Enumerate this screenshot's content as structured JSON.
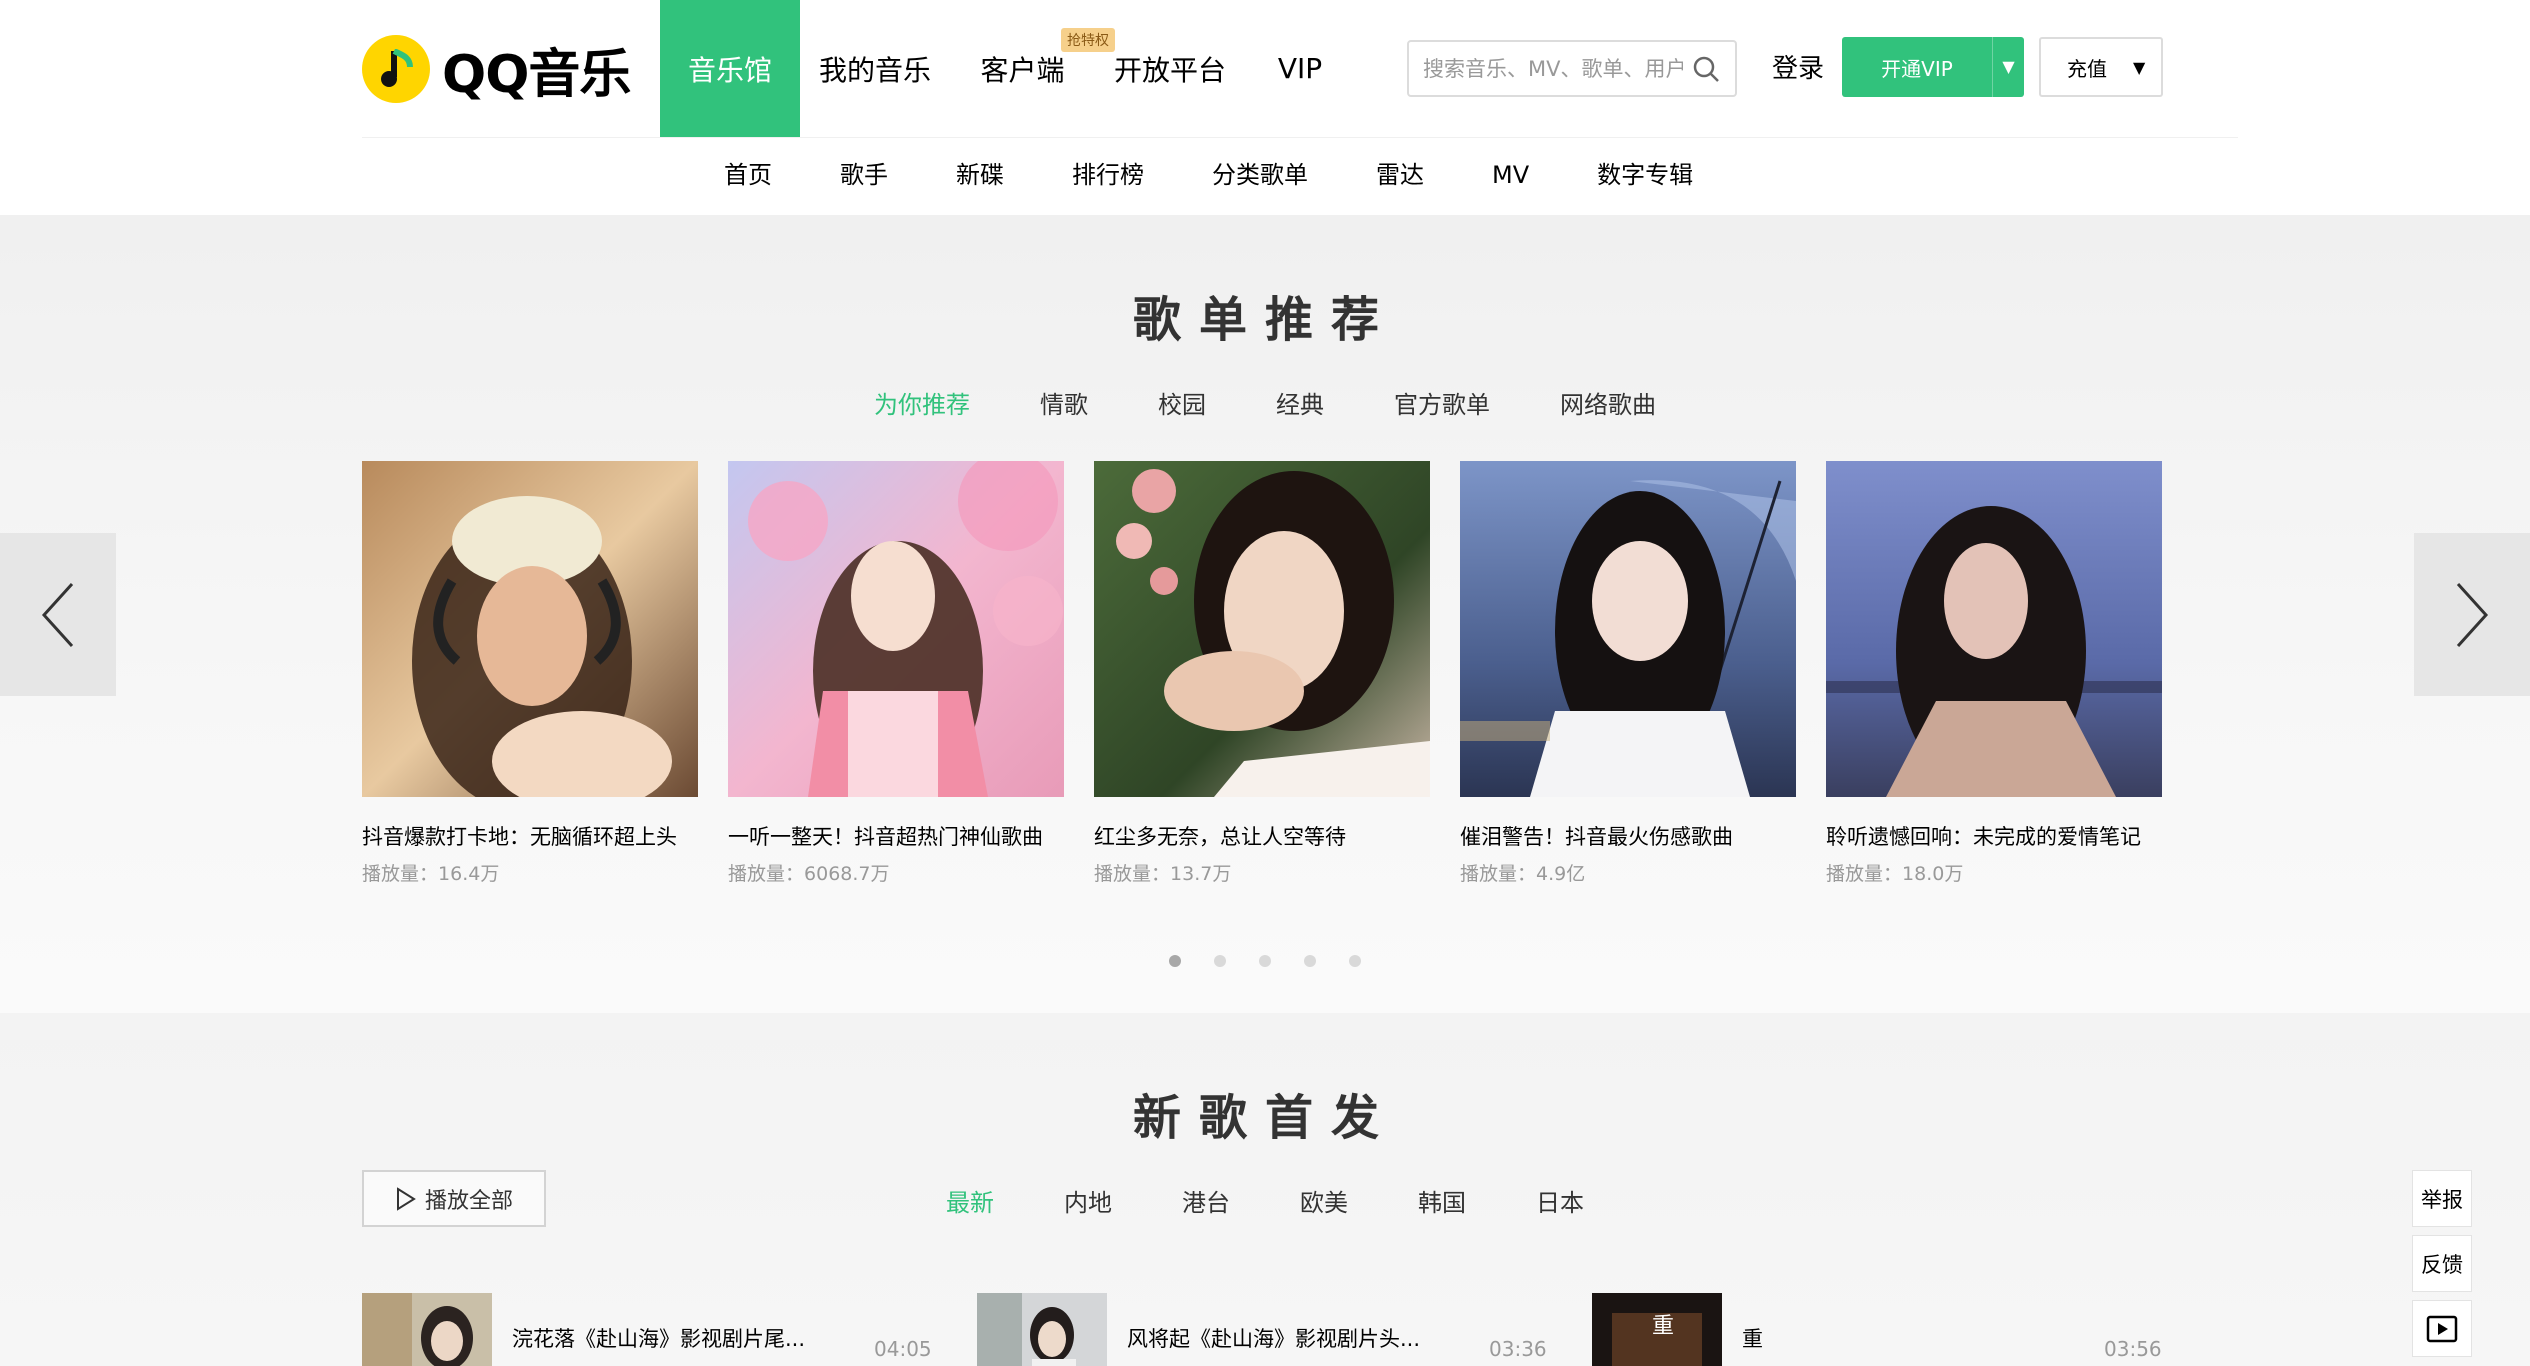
{
  "brand": {
    "logo_text": "QQ音乐",
    "colors": {
      "accent": "#31c27c",
      "logo_yellow": "#ffd500"
    }
  },
  "topnav": {
    "items": [
      {
        "label": "音乐馆",
        "active": true
      },
      {
        "label": "我的音乐"
      },
      {
        "label": "客户端",
        "badge": "抢特权"
      },
      {
        "label": "开放平台"
      },
      {
        "label": "VIP"
      }
    ]
  },
  "search": {
    "placeholder": "搜索音乐、MV、歌单、用户",
    "icon": "search-icon"
  },
  "account": {
    "login_label": "登录",
    "vip_label": "开通VIP",
    "recharge_label": "充值"
  },
  "subnav": {
    "items": [
      "首页",
      "歌手",
      "新碟",
      "排行榜",
      "分类歌单",
      "雷达",
      "MV",
      "数字专辑"
    ]
  },
  "playlists": {
    "title": "歌单推荐",
    "tabs": [
      "为你推荐",
      "情歌",
      "校园",
      "经典",
      "官方歌单",
      "网络歌曲"
    ],
    "active_tab": "为你推荐",
    "plays_prefix": "播放量：",
    "cards": [
      {
        "name": "抖音爆款打卡地：无脑循环超上头",
        "plays": "16.4万"
      },
      {
        "name": "一听一整天！抖音超热门神仙歌曲",
        "plays": "6068.7万"
      },
      {
        "name": "红尘多无奈，总让人空等待",
        "plays": "13.7万"
      },
      {
        "name": "催泪警告！抖音最火伤感歌曲",
        "plays": "4.9亿"
      },
      {
        "name": "聆听遗憾回响：未完成的爱情笔记",
        "plays": "18.0万"
      }
    ],
    "pages": 5,
    "active_page": 1
  },
  "new_songs": {
    "title": "新歌首发",
    "play_all_label": "播放全部",
    "tabs": [
      "最新",
      "内地",
      "港台",
      "欧美",
      "韩国",
      "日本"
    ],
    "active_tab": "最新",
    "songs": [
      {
        "title": "浣花落《赴山海》影视剧片尾...",
        "artist": "…",
        "duration": "04:05"
      },
      {
        "title": "风将起《赴山海》影视剧片头...",
        "artist": "…",
        "duration": "03:36"
      },
      {
        "title": "重",
        "artist": "…",
        "duration": "03:56"
      }
    ]
  },
  "side_tools": {
    "report_label": "举报",
    "feedback_label": "反馈",
    "play_icon": "play-box-icon"
  }
}
